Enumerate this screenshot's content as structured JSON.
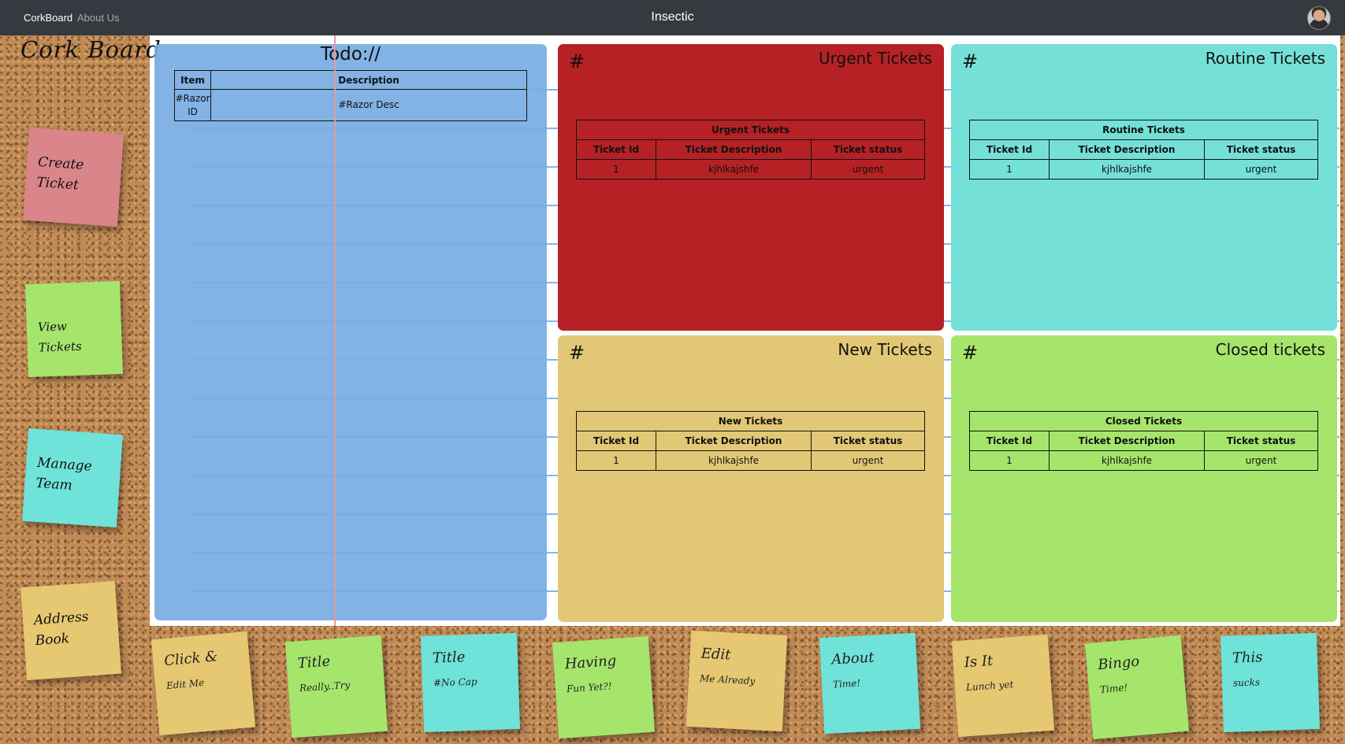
{
  "navbar": {
    "brand": "CorkBoard",
    "about": "About Us",
    "title": "Insectic",
    "avatar_icon": "user-avatar"
  },
  "sidebar": {
    "logo": "Cork Board",
    "notes": [
      {
        "line1": "Create",
        "line2": "Ticket",
        "color": "#d98589"
      },
      {
        "line1": "View Tickets",
        "line2": "",
        "color": "#a6e56c"
      },
      {
        "line1": "Manage",
        "line2": "Team",
        "color": "#6fe3d9"
      },
      {
        "line1": "Address",
        "line2": "Book",
        "color": "#e6c872"
      }
    ]
  },
  "todo": {
    "title": "Todo://",
    "headers": [
      "Item",
      "Description"
    ],
    "rows": [
      {
        "item": "#Razor ID",
        "description": "#Razor Desc"
      }
    ]
  },
  "panels": {
    "urgent": {
      "hash": "#",
      "title": "Urgent Tickets",
      "table_caption": "Urgent Tickets",
      "color": "#b62125",
      "headers": [
        "Ticket Id",
        "Ticket Description",
        "Ticket status"
      ],
      "rows": [
        {
          "id": "1",
          "description": "kjhlkajshfe",
          "status": "urgent"
        }
      ]
    },
    "routine": {
      "hash": "#",
      "title": "Routine Tickets",
      "table_caption": "Routine Tickets",
      "color": "#74e0d8",
      "headers": [
        "Ticket Id",
        "Ticket Description",
        "Ticket status"
      ],
      "rows": [
        {
          "id": "1",
          "description": "kjhlkajshfe",
          "status": "urgent"
        }
      ]
    },
    "new": {
      "hash": "#",
      "title": "New Tickets",
      "table_caption": "New Tickets",
      "color": "#e2c876",
      "headers": [
        "Ticket Id",
        "Ticket Description",
        "Ticket status"
      ],
      "rows": [
        {
          "id": "1",
          "description": "kjhlkajshfe",
          "status": "urgent"
        }
      ]
    },
    "closed": {
      "hash": "#",
      "title": "Closed tickets",
      "table_caption": "Closed Tickets",
      "color": "#a6e56c",
      "headers": [
        "Ticket Id",
        "Ticket Description",
        "Ticket status"
      ],
      "rows": [
        {
          "id": "1",
          "description": "kjhlkajshfe",
          "status": "urgent"
        }
      ]
    }
  },
  "bottom_notes": [
    {
      "title": "Click &",
      "body": "Edit Me"
    },
    {
      "title": "Title",
      "body": "Really..Try"
    },
    {
      "title": "Title",
      "body": "#No Cap"
    },
    {
      "title": "Having",
      "body": "Fun Yet?!"
    },
    {
      "title": "Edit",
      "body": "Me Already"
    },
    {
      "title": "About",
      "body": "Time!"
    },
    {
      "title": "Is It",
      "body": "Lunch yet"
    },
    {
      "title": "Bingo",
      "body": "Time!"
    },
    {
      "title": "This",
      "body": "sucks"
    }
  ]
}
